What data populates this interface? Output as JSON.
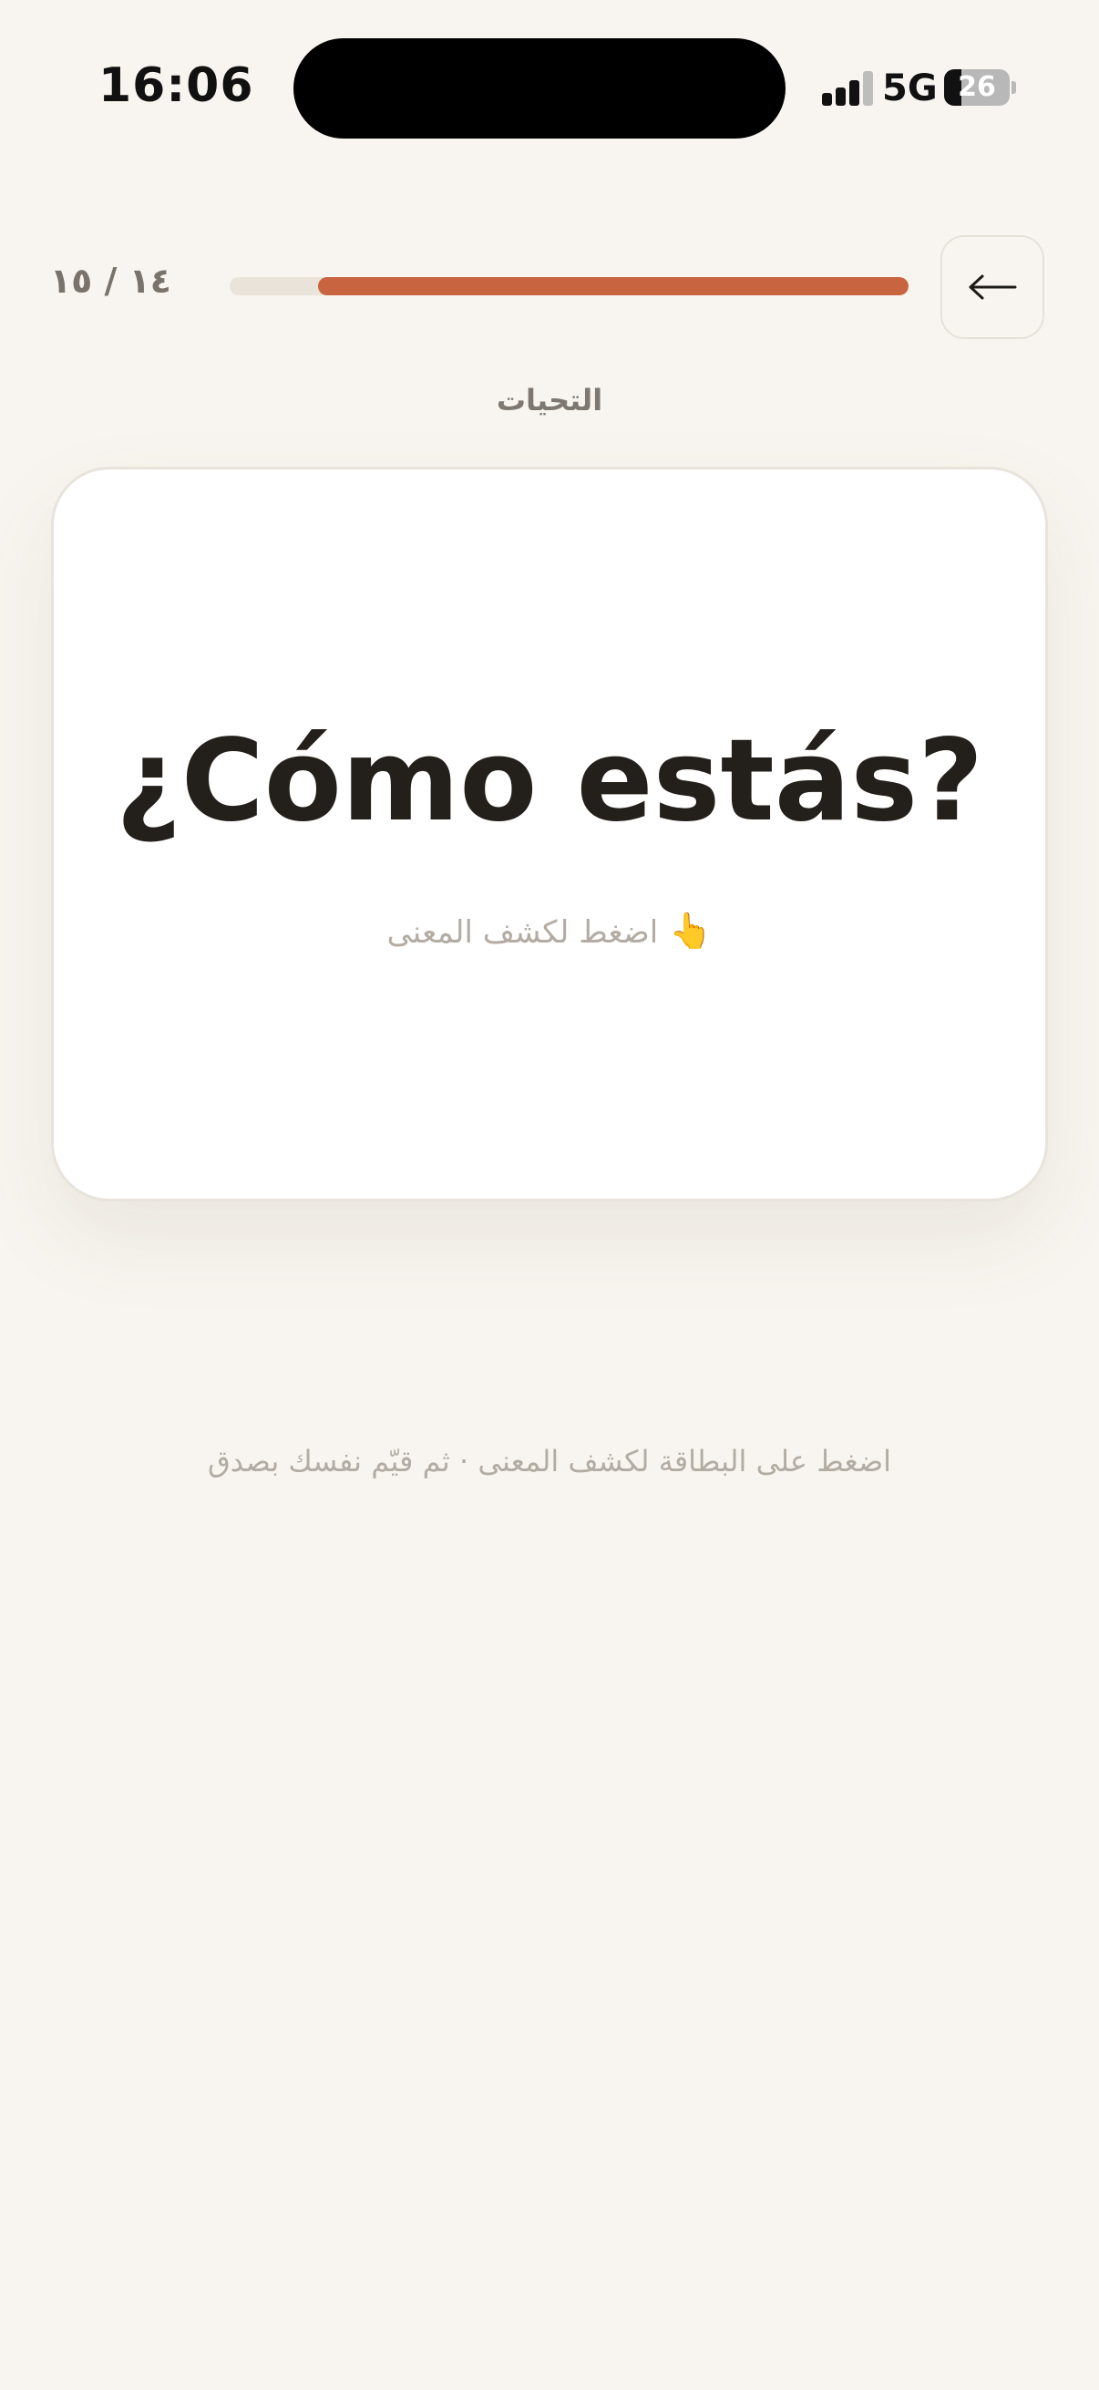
{
  "status_bar": {
    "time": "16:06",
    "network": "5G",
    "battery_level": "26",
    "battery_fraction": 0.26
  },
  "header": {
    "back_icon": "arrow-left-icon",
    "progress_count": "١٤ / ١٥",
    "progress_fraction": 0.87,
    "progress_color": "#c8643f"
  },
  "category": {
    "label": "التحيات"
  },
  "card": {
    "word": "¿Cómo estás?",
    "hint_icon": "pointing-hand-icon",
    "hint_glyph": "👆",
    "hint": "اضغط لكشف المعنى"
  },
  "footer": {
    "instruction": "اضغط على البطاقة لكشف المعنى · ثم قيّم نفسك بصدق"
  }
}
